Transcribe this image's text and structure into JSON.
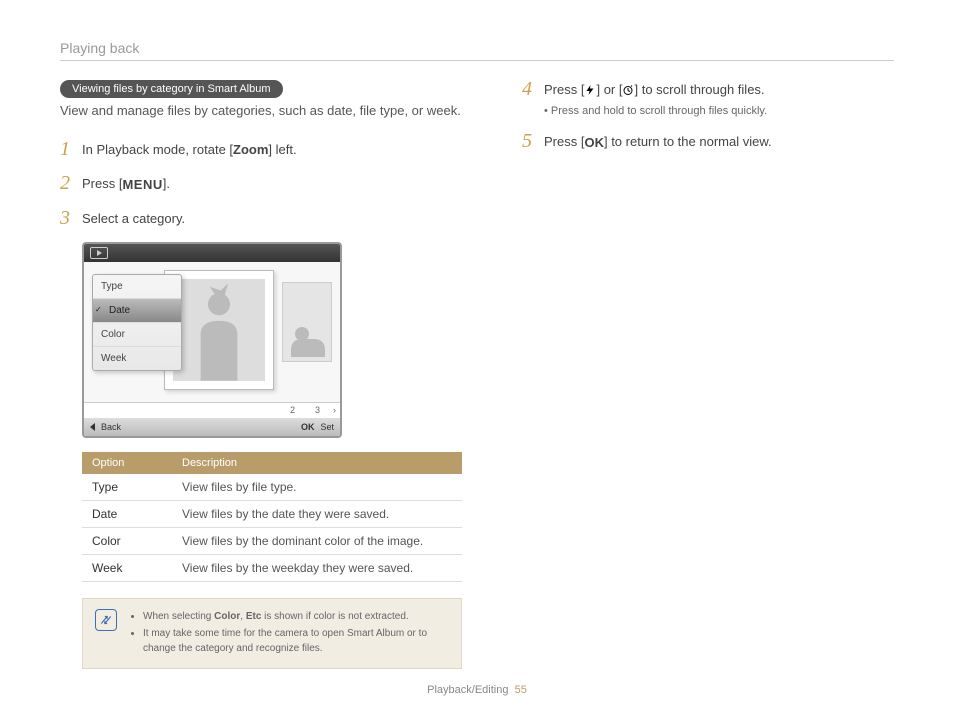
{
  "header": "Playing back",
  "pill": "Viewing files by category in Smart Album",
  "intro": "View and manage files by categories, such as date, file type, or week.",
  "steps_left": [
    {
      "num": "1",
      "pre": "In Playback mode, rotate [",
      "bold": "Zoom",
      "post": "] left."
    },
    {
      "num": "2",
      "pre": "Press [",
      "glyph": "MENU",
      "post": "]."
    },
    {
      "num": "3",
      "pre": "Select a category.",
      "bold": "",
      "post": ""
    }
  ],
  "screen": {
    "menu": [
      "Type",
      "Date",
      "Color",
      "Week"
    ],
    "selected": "Date",
    "nums": [
      "2",
      "3"
    ],
    "back": "Back",
    "set": "Set",
    "ok": "OK"
  },
  "table": {
    "headers": [
      "Option",
      "Description"
    ],
    "rows": [
      [
        "Type",
        "View files by file type."
      ],
      [
        "Date",
        "View files by the date they were saved."
      ],
      [
        "Color",
        "View files by the dominant color of the image."
      ],
      [
        "Week",
        "View files by the weekday they were saved."
      ]
    ]
  },
  "note": {
    "items": [
      {
        "pre": "When selecting ",
        "b1": "Color",
        "mid": ", ",
        "b2": "Etc",
        "post": " is shown if color is not extracted."
      },
      {
        "text": "It may take some time for the camera to open Smart Album or to change the category and recognize files."
      }
    ]
  },
  "steps_right": [
    {
      "num": "4",
      "text_a": "Press [",
      "icon1": "flash",
      "text_b": "] or [",
      "icon2": "timer",
      "text_c": "] to scroll through files.",
      "sub": "Press and hold to scroll through files quickly."
    },
    {
      "num": "5",
      "text_a": "Press [",
      "glyph": "OK",
      "text_c": "] to return to the normal view."
    }
  ],
  "footer": {
    "section": "Playback/Editing",
    "page": "55"
  }
}
